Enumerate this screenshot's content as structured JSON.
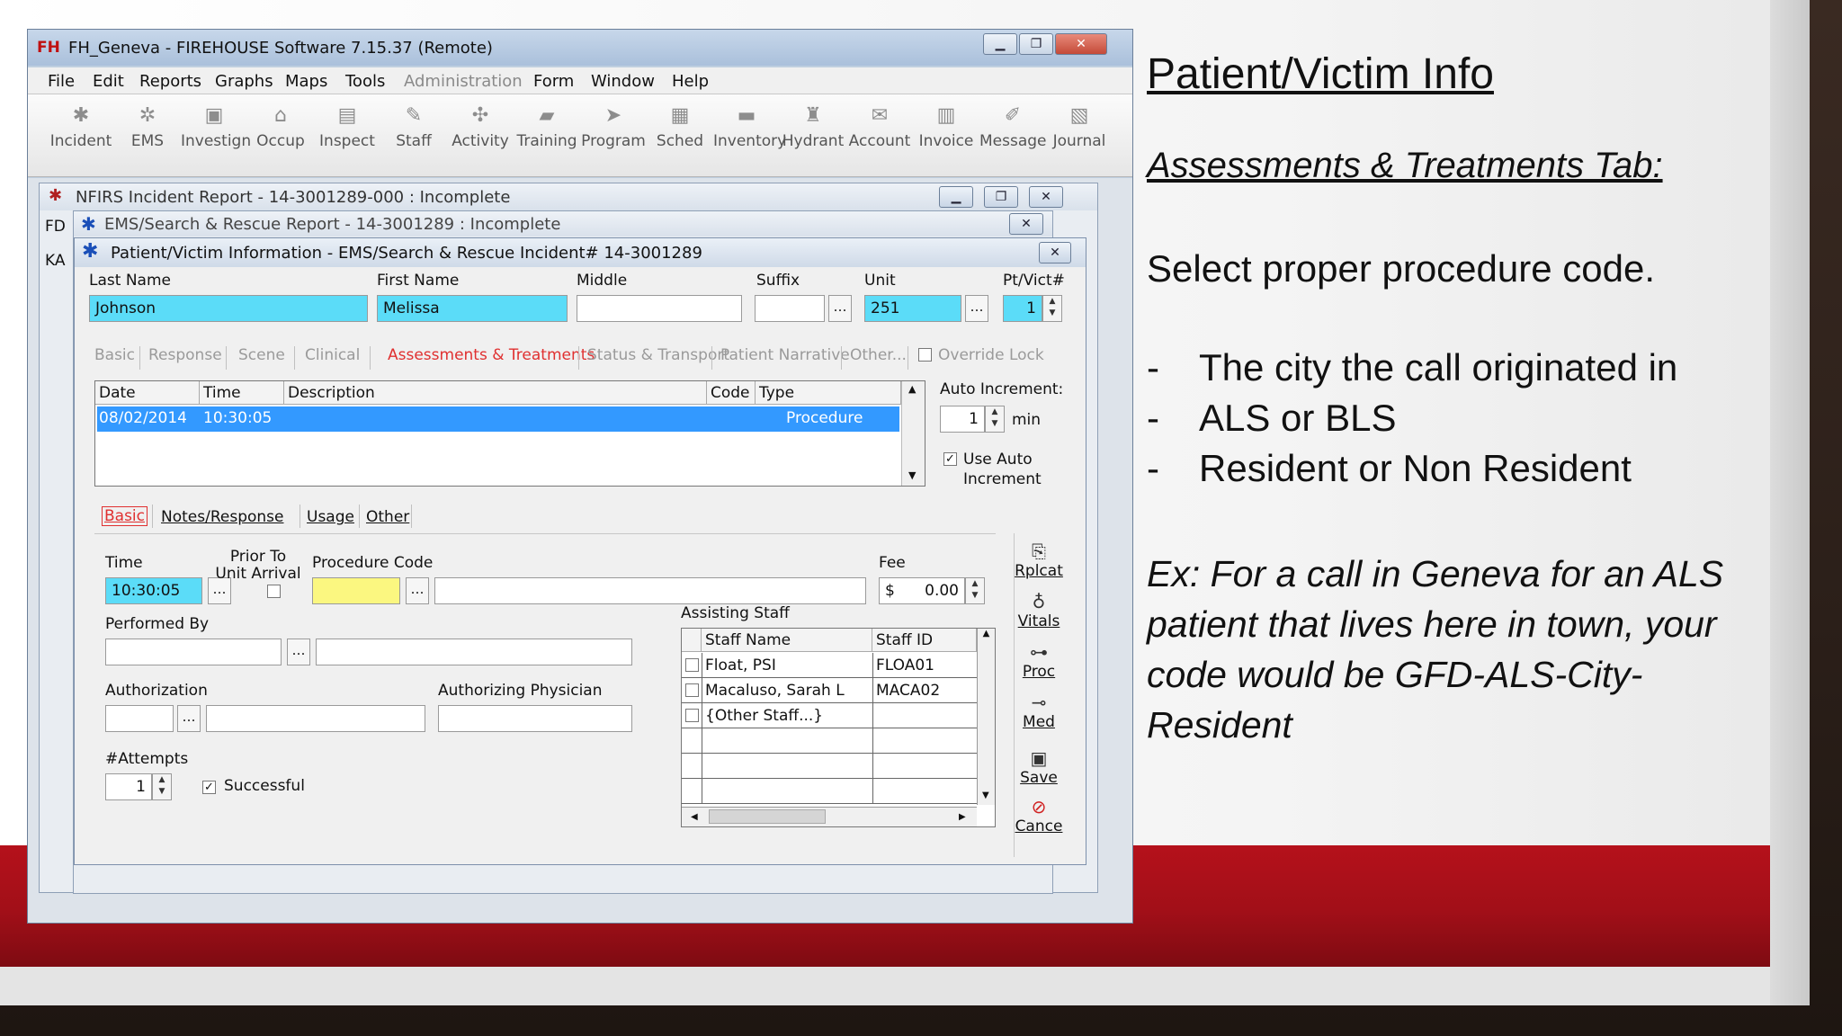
{
  "slide": {
    "title": "Patient/Victim Info",
    "subtitle": "Assessments & Treatments Tab:",
    "instruction": "Select proper procedure code.",
    "bullets": [
      "The city the call originated in",
      "ALS or BLS",
      "Resident or Non Resident"
    ],
    "bullet_marker": "-",
    "example": "Ex:  For a call in Geneva for an ALS patient that lives here in town, your code would be GFD-ALS-City-Resident",
    "colors": {
      "red_band": "#a10f18",
      "background": "#ffffff"
    }
  },
  "app": {
    "logo": "FH",
    "title": "FH_Geneva - FIREHOUSE Software 7.15.37 (Remote)",
    "menu": [
      "File",
      "Edit",
      "Reports",
      "Graphs",
      "Maps",
      "Tools",
      "Administration",
      "Form",
      "Window",
      "Help"
    ],
    "toolbar": [
      {
        "label": "Incident",
        "icon": "incident-icon",
        "glyph": "✱"
      },
      {
        "label": "EMS",
        "icon": "ems-icon",
        "glyph": "✲"
      },
      {
        "label": "Investign",
        "icon": "investigation-icon",
        "glyph": "▣"
      },
      {
        "label": "Occup",
        "icon": "occupancy-icon",
        "glyph": "⌂"
      },
      {
        "label": "Inspect",
        "icon": "inspect-icon",
        "glyph": "▤"
      },
      {
        "label": "Staff",
        "icon": "staff-icon",
        "glyph": "✎"
      },
      {
        "label": "Activity",
        "icon": "activity-icon",
        "glyph": "✣"
      },
      {
        "label": "Training",
        "icon": "training-icon",
        "glyph": "▰"
      },
      {
        "label": "Program",
        "icon": "program-icon",
        "glyph": "➤"
      },
      {
        "label": "Sched",
        "icon": "schedule-icon",
        "glyph": "▦"
      },
      {
        "label": "Inventory",
        "icon": "inventory-icon",
        "glyph": "▬"
      },
      {
        "label": "Hydrant",
        "icon": "hydrant-icon",
        "glyph": "♜"
      },
      {
        "label": "Account",
        "icon": "account-icon",
        "glyph": "✉"
      },
      {
        "label": "Invoice",
        "icon": "invoice-icon",
        "glyph": "▥"
      },
      {
        "label": "Message",
        "icon": "message-icon",
        "glyph": "✐"
      },
      {
        "label": "Journal",
        "icon": "journal-icon",
        "glyph": "▧"
      }
    ],
    "back_windows": {
      "nfirs": "NFIRS Incident Report  - 14-3001289-000  : Incomplete",
      "ems": "EMS/Search & Rescue Report  - 14-3001289  : Incomplete",
      "nfirs_left_stub": "FD",
      "ems_left_stub": "KA"
    }
  },
  "dialog": {
    "title": "Patient/Victim Information - EMS/Search & Rescue Incident# 14-3001289",
    "labels": {
      "last": "Last Name",
      "first": "First Name",
      "middle": "Middle",
      "suffix": "Suffix",
      "unit": "Unit",
      "ptvict": "Pt/Vict#"
    },
    "values": {
      "last": "Johnson",
      "first": "Melissa",
      "middle": "",
      "suffix": "",
      "unit": "251",
      "ptvict": "1"
    },
    "tabs": [
      "Basic",
      "Response",
      "Scene",
      "Clinical",
      "Assessments & Treatments",
      "Status & Transport",
      "Patient Narrative",
      "Other..."
    ],
    "active_tab": "Assessments & Treatments",
    "override_lock": "Override Lock",
    "grid_headers": [
      "Date",
      "Time",
      "Description",
      "Code",
      "Type"
    ],
    "grid_rows": [
      {
        "date": "08/02/2014",
        "time": "10:30:05",
        "description": "",
        "code": "",
        "type": "Procedure"
      }
    ],
    "auto_increment_label": "Auto Increment:",
    "auto_increment_value": "1",
    "auto_increment_unit": "min",
    "use_auto_increment": "Use Auto Increment",
    "subtabs": [
      "Basic",
      "Notes/Response",
      "Usage",
      "Other"
    ],
    "basic": {
      "time_label": "Time",
      "time_value": "10:30:05",
      "prior_label": "Prior To Unit Arrival",
      "procedure_label": "Procedure Code",
      "procedure_value": "",
      "procedure_desc": "",
      "fee_label": "Fee",
      "fee_currency": "$",
      "fee_value": "0.00",
      "performed_label": "Performed By",
      "authorization_label": "Authorization",
      "physician_label": "Authorizing Physician",
      "attempts_label": "#Attempts",
      "attempts_value": "1",
      "successful_label": "Successful",
      "assisting_label": "Assisting Staff",
      "staff_headers": [
        "Staff Name",
        "Staff ID"
      ],
      "staff_rows": [
        {
          "name": "Float, PSI",
          "id": "FLOA01"
        },
        {
          "name": "Macaluso, Sarah L",
          "id": "MACA02"
        },
        {
          "name": "{Other Staff...}",
          "id": ""
        }
      ]
    },
    "side_buttons": [
      {
        "label": "Rplcat",
        "icon": "replicate-icon",
        "glyph": "⎘"
      },
      {
        "label": "Vitals",
        "icon": "stethoscope-icon",
        "glyph": "♁"
      },
      {
        "label": "Proc",
        "icon": "procedure-icon",
        "glyph": "⊶"
      },
      {
        "label": "Med",
        "icon": "medication-icon",
        "glyph": "⊸"
      },
      {
        "label": "Save",
        "icon": "save-icon",
        "glyph": "▣"
      },
      {
        "label": "Cance",
        "icon": "cancel-icon",
        "glyph": "⊘"
      }
    ]
  }
}
